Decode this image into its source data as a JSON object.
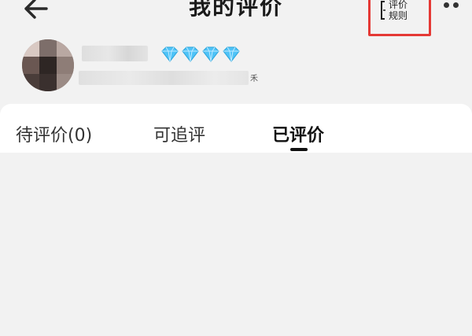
{
  "header": {
    "title": "我的评价",
    "rules_label": "评价\n规则",
    "back_icon": "arrow-left-icon",
    "more_icon": "more-dots-icon"
  },
  "profile": {
    "avatar_icon": "avatar",
    "level_icon": "diamond-icon",
    "level_count": 4,
    "tiny_mark": "禾"
  },
  "tabs": [
    {
      "label": "待评价(0)",
      "active": false
    },
    {
      "label": "可追评",
      "active": false
    },
    {
      "label": "已评价",
      "active": true
    }
  ],
  "colors": {
    "highlight_box": "#e53935",
    "diamond": "#4fc3f7",
    "background": "#f2f2f2",
    "active_text": "#111111"
  }
}
